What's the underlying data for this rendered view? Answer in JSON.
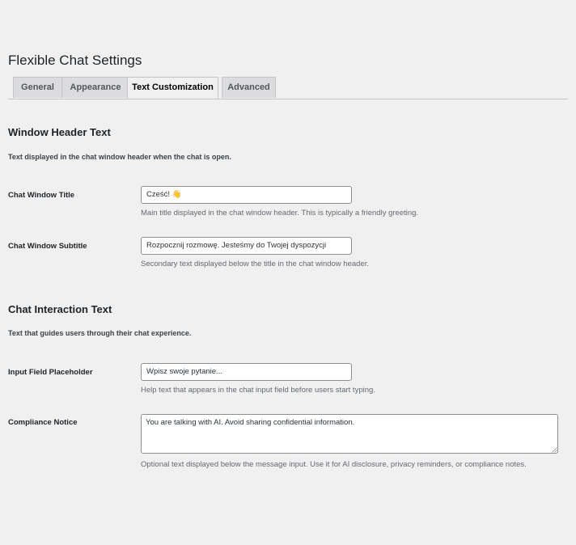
{
  "page": {
    "title": "Flexible Chat Settings"
  },
  "tabs": [
    {
      "label": "General",
      "active": false
    },
    {
      "label": "Appearance",
      "active": false
    },
    {
      "label": "Text Customization",
      "active": true
    },
    {
      "label": "Advanced",
      "active": false
    }
  ],
  "sections": {
    "window_header": {
      "title": "Window Header Text",
      "description": "Text displayed in the chat window header when the chat is open."
    },
    "chat_interaction": {
      "title": "Chat Interaction Text",
      "description": "Text that guides users through their chat experience."
    }
  },
  "fields": {
    "window_title": {
      "label": "Chat Window Title",
      "value": "Cześć! 👋",
      "help": "Main title displayed in the chat window header. This is typically a friendly greeting."
    },
    "window_subtitle": {
      "label": "Chat Window Subtitle",
      "value": "Rozpocznij rozmowę. Jesteśmy do Twojej dyspozycji",
      "help": "Secondary text displayed below the title in the chat window header."
    },
    "input_placeholder": {
      "label": "Input Field Placeholder",
      "value": "Wpisz swoje pytanie...",
      "help": "Help text that appears in the chat input field before users start typing."
    },
    "compliance_notice": {
      "label": "Compliance Notice",
      "value": "You are talking with AI. Avoid sharing confidential information.",
      "help": "Optional text displayed below the message input. Use it for AI disclosure, privacy reminders, or compliance notes."
    }
  },
  "colors": {
    "background": "#f0f0f1",
    "active_tab": "#f0f0f1",
    "inactive_tab": "#dcdcde",
    "help_text": "#646970",
    "input_border": "#8c8f94"
  }
}
